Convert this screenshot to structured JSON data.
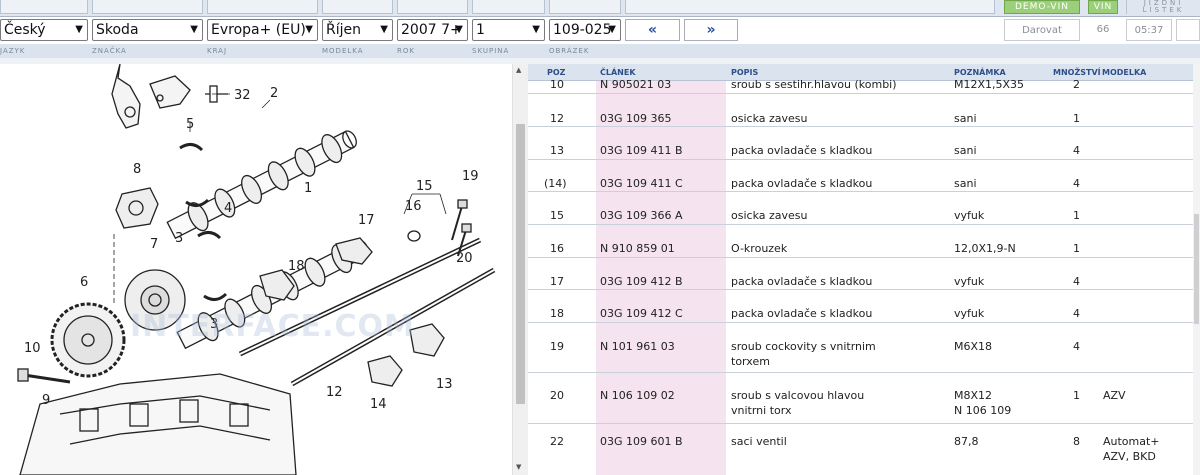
{
  "topbar": {
    "demo_vin": "DEMO-VIN",
    "vin": "VIN",
    "jizdni_listek": "JÍZDNÍ LÍSTEK"
  },
  "selectors": {
    "jazyk": "Český",
    "znacka": "Skoda",
    "kraj": "Evropa+ (EU)",
    "modelka": "Říjen",
    "rok": "2007 7+",
    "skupina": "1",
    "obrazek": "109-025",
    "prev_label": "«",
    "next_label": "»",
    "darovat": "Darovat",
    "count": "66",
    "time": "05:37"
  },
  "labels": {
    "jazyk": "JAZYK",
    "znacka": "ZNAČKA",
    "kraj": "KRAJ",
    "modelka": "MODELKA",
    "rok": "ROK",
    "skupina": "SKUPINA",
    "obrazek": "OBRÁZEK"
  },
  "diagram": {
    "watermark": "INTERFACE.COM",
    "callouts": [
      "32",
      "2",
      "5",
      "8",
      "1",
      "4",
      "15",
      "19",
      "16",
      "17",
      "3",
      "7",
      "20",
      "18",
      "3",
      "6",
      "12",
      "10",
      "9",
      "14",
      "13"
    ]
  },
  "table": {
    "headers": {
      "poz": "POZ",
      "clanek": "ČLÁNEK",
      "popis": "POPIS",
      "poznamka": "POZNÁMKA",
      "mnozstvi": "MNOŽSTVÍ",
      "modelka": "MODELKA"
    },
    "rows": [
      {
        "poz": "10",
        "clanek": "N 905021 03",
        "popis": "sroub s sestihr.hlavou (kombi)",
        "poznamka": "M12X1,5X35",
        "mnozstvi": "2",
        "modelka": ""
      },
      {
        "poz": "12",
        "clanek": "03G 109 365",
        "popis": "osicka zavesu",
        "poznamka": "sani",
        "mnozstvi": "1",
        "modelka": ""
      },
      {
        "poz": "13",
        "clanek": "03G 109 411 B",
        "popis": "packa ovladače s kladkou",
        "poznamka": "sani",
        "mnozstvi": "4",
        "modelka": ""
      },
      {
        "poz": "(14)",
        "clanek": "03G 109 411 C",
        "popis": "packa ovladače s kladkou",
        "poznamka": "sani",
        "mnozstvi": "4",
        "modelka": ""
      },
      {
        "poz": "15",
        "clanek": "03G 109 366 A",
        "popis": "osicka zavesu",
        "poznamka": "vyfuk",
        "mnozstvi": "1",
        "modelka": ""
      },
      {
        "poz": "16",
        "clanek": "N 910 859 01",
        "popis": "O-krouzek",
        "poznamka": "12,0X1,9-N",
        "mnozstvi": "1",
        "modelka": ""
      },
      {
        "poz": "17",
        "clanek": "03G 109 412 B",
        "popis": "packa ovladače s kladkou",
        "poznamka": "vyfuk",
        "mnozstvi": "4",
        "modelka": ""
      },
      {
        "poz": "18",
        "clanek": "03G 109 412 C",
        "popis": "packa ovladače s kladkou",
        "poznamka": "vyfuk",
        "mnozstvi": "4",
        "modelka": ""
      },
      {
        "poz": "19",
        "clanek": "N 101 961 03",
        "popis": "sroub cockovity s vnitrnim",
        "popis2": "torxem",
        "poznamka": "M6X18",
        "poznamka2": "",
        "mnozstvi": "4",
        "modelka": "",
        "modelka2": ""
      },
      {
        "poz": "20",
        "clanek": "N 106 109 02",
        "popis": "sroub s valcovou hlavou",
        "popis2": "vnitrni torx",
        "poznamka": "M8X12",
        "poznamka2": "N 106 109",
        "mnozstvi": "1",
        "modelka": "AZV",
        "modelka2": ""
      },
      {
        "poz": "22",
        "clanek": "03G 109 601 B",
        "popis": "saci ventil",
        "popis2": "",
        "poznamka": "87,8",
        "poznamka2": "",
        "mnozstvi": "8",
        "modelka": "Automat+",
        "modelka2": "AZV, BKD"
      }
    ]
  },
  "colors": {
    "header_bg": "#dbe3ee",
    "pink_column": "#f5e4ef",
    "green_button": "#9ccf7a",
    "link_blue": "#2a4d9b"
  }
}
